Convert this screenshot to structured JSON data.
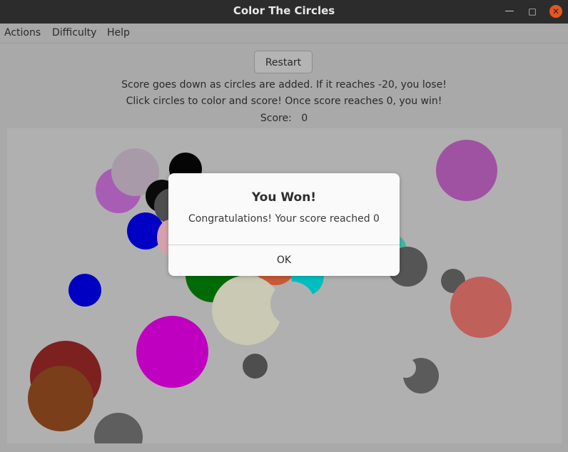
{
  "window": {
    "title": "Color The Circles"
  },
  "menu": {
    "items": [
      "Actions",
      "Difficulty",
      "Help"
    ]
  },
  "controls": {
    "restart_label": "Restart"
  },
  "instructions": {
    "line1": "Score goes down as circles are added. If it reaches -20, you lose!",
    "line2": "Click circles to color and score! Once score reaches 0, you win!"
  },
  "score": {
    "label": "Score:",
    "value": "0"
  },
  "dialog": {
    "title": "You Won!",
    "message": "Congratulations! Your score reached 0",
    "ok_label": "OK"
  },
  "colors": {
    "canvas_bg": "#b0b0b0",
    "window_bg": "#a9a9a9",
    "close_button": "#e95420"
  },
  "circles": [
    "purple",
    "mauve",
    "black",
    "black",
    "dark-gray",
    "blue",
    "pink",
    "green",
    "tan",
    "teal",
    "orange",
    "gray",
    "gray",
    "salmon",
    "violet",
    "blue",
    "magenta",
    "dark-red",
    "brown",
    "gray",
    "gray",
    "gray"
  ]
}
